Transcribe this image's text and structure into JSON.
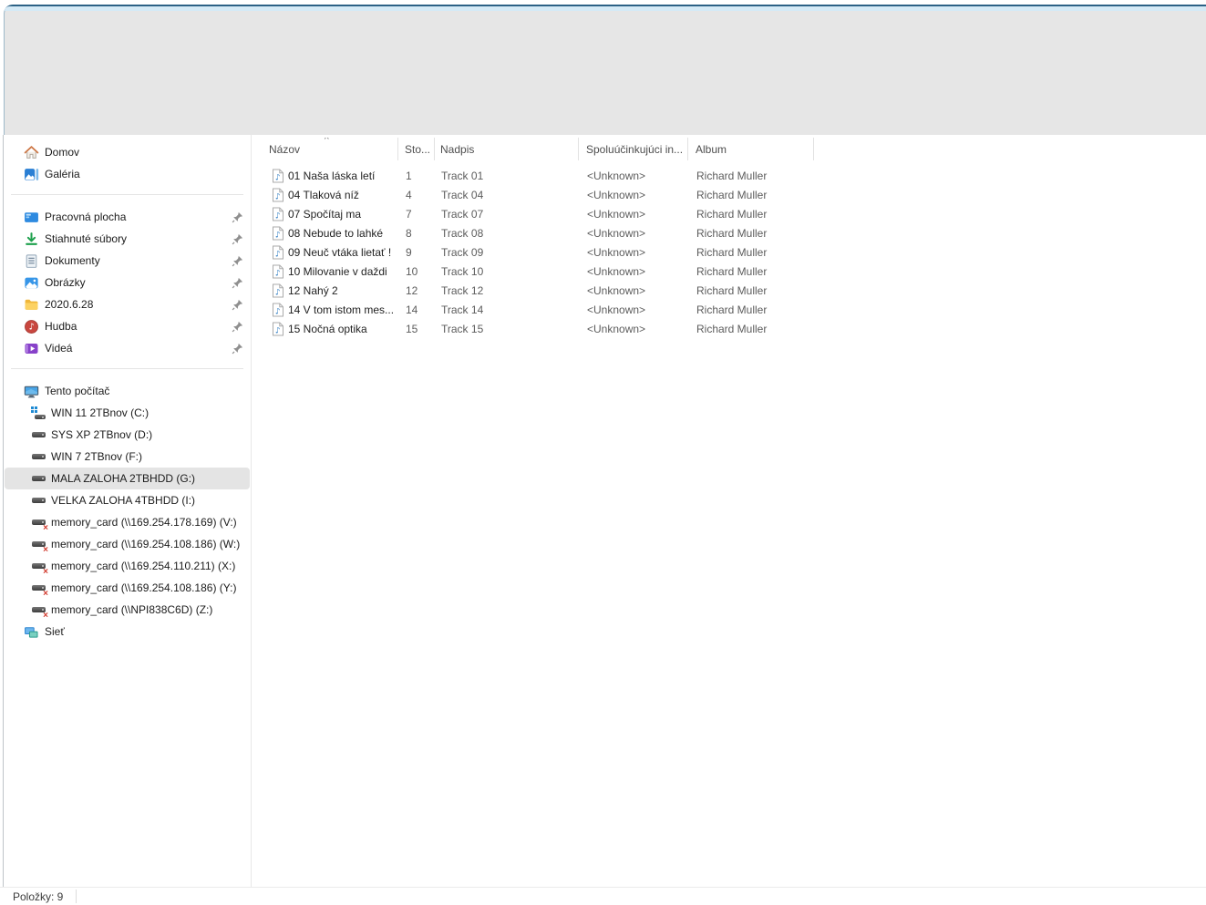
{
  "toolbar": {
    "note": ""
  },
  "sidebar": {
    "items": [
      {
        "label": "Domov",
        "icon": "home-icon"
      },
      {
        "label": "Galéria",
        "icon": "gallery-icon"
      },
      {
        "label": "Pracovná plocha",
        "icon": "desktop-icon",
        "pinned": true
      },
      {
        "label": "Stiahnuté súbory",
        "icon": "downloads-icon",
        "pinned": true
      },
      {
        "label": "Dokumenty",
        "icon": "documents-icon",
        "pinned": true
      },
      {
        "label": "Obrázky",
        "icon": "pictures-icon",
        "pinned": true
      },
      {
        "label": "2020.6.28",
        "icon": "folder-icon",
        "pinned": true
      },
      {
        "label": "Hudba",
        "icon": "music-icon",
        "pinned": true
      },
      {
        "label": "Videá",
        "icon": "videos-icon",
        "pinned": true
      },
      {
        "label": "Tento počítač",
        "icon": "this-pc-icon"
      },
      {
        "label": "WIN 11 2TBnov (C:)",
        "icon": "system-drive-icon"
      },
      {
        "label": "SYS XP 2TBnov (D:)",
        "icon": "drive-icon"
      },
      {
        "label": "WIN 7 2TBnov (F:)",
        "icon": "drive-icon"
      },
      {
        "label": "MALA ZALOHA 2TBHDD (G:)",
        "icon": "drive-icon",
        "selected": true
      },
      {
        "label": "VELKA ZALOHA 4TBHDD (I:)",
        "icon": "drive-icon"
      },
      {
        "label": "memory_card (\\\\169.254.178.169) (V:)",
        "icon": "network-drive-icon"
      },
      {
        "label": "memory_card (\\\\169.254.108.186) (W:)",
        "icon": "network-drive-icon"
      },
      {
        "label": "memory_card (\\\\169.254.110.211) (X:)",
        "icon": "network-drive-icon"
      },
      {
        "label": "memory_card (\\\\169.254.108.186) (Y:)",
        "icon": "network-drive-icon"
      },
      {
        "label": "memory_card (\\\\NPI838C6D) (Z:)",
        "icon": "network-drive-icon"
      },
      {
        "label": "Sieť",
        "icon": "network-icon"
      }
    ]
  },
  "list": {
    "columns": {
      "name": "Názov",
      "track": "Sto...",
      "title": "Nadpis",
      "artists": "Spoluúčinkujúci in...",
      "album": "Album"
    },
    "sort": {
      "column": "Názov",
      "direction": "ascending"
    },
    "rows": [
      {
        "name": "01 Naša láska letí",
        "track": "1",
        "title": "Track 01",
        "artists": "<Unknown>",
        "album": "Richard Muller"
      },
      {
        "name": "04 Tlaková níž",
        "track": "4",
        "title": "Track 04",
        "artists": "<Unknown>",
        "album": "Richard Muller"
      },
      {
        "name": "07 Spočítaj ma",
        "track": "7",
        "title": "Track 07",
        "artists": "<Unknown>",
        "album": "Richard Muller"
      },
      {
        "name": "08 Nebude to lahké",
        "track": "8",
        "title": "Track 08",
        "artists": "<Unknown>",
        "album": "Richard Muller"
      },
      {
        "name": "09 Neuč vtáka lietať !",
        "track": "9",
        "title": "Track 09",
        "artists": "<Unknown>",
        "album": "Richard Muller"
      },
      {
        "name": "10 Milovanie v daždi",
        "track": "10",
        "title": "Track 10",
        "artists": "<Unknown>",
        "album": "Richard Muller"
      },
      {
        "name": "12 Nahý 2",
        "track": "12",
        "title": "Track 12",
        "artists": "<Unknown>",
        "album": "Richard Muller"
      },
      {
        "name": "14 V tom istom mes...",
        "track": "14",
        "title": "Track 14",
        "artists": "<Unknown>",
        "album": "Richard Muller"
      },
      {
        "name": "15 Nočná optika",
        "track": "15",
        "title": "Track 15",
        "artists": "<Unknown>",
        "album": "Richard Muller"
      }
    ]
  },
  "status": {
    "items_label": "Položky: 9"
  },
  "colors": {
    "toolbar_bg": "#e6e6e6",
    "window_top_border": "#2c6286",
    "window_top_strip": "#d5eaf6",
    "selected_item_bg": "#e4e4e4",
    "secondary_text": "#5c5c5c",
    "audio_note_blue": "#2e7cc3"
  }
}
